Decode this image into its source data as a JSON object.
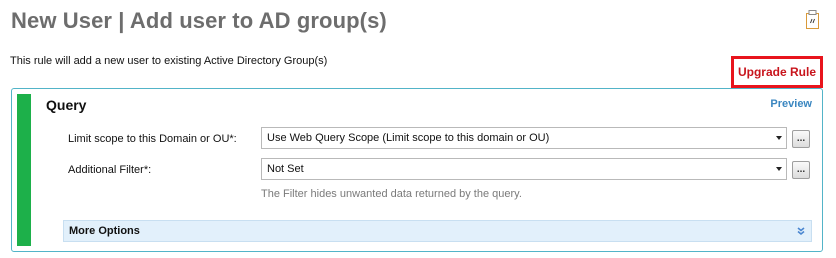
{
  "page": {
    "title": "New User | Add user to AD group(s)",
    "description": "This rule will add a new user to existing Active Directory Group(s)",
    "upgrade_rule_label": "Upgrade Rule",
    "doc_icon": "document-edit-icon"
  },
  "query_section": {
    "title": "Query",
    "preview_label": "Preview",
    "accent_color": "#1db04a",
    "fields": [
      {
        "label": "Limit scope to this Domain or OU*:",
        "value": "Use Web Query Scope (Limit scope to this domain or OU)",
        "browse_label": "..."
      },
      {
        "label": "Additional Filter*:",
        "value": "Not Set",
        "browse_label": "...",
        "hint": "The Filter hides unwanted data returned by the query."
      }
    ],
    "more_options_label": "More Options",
    "more_options_icon": "chevron-double-down-icon"
  }
}
